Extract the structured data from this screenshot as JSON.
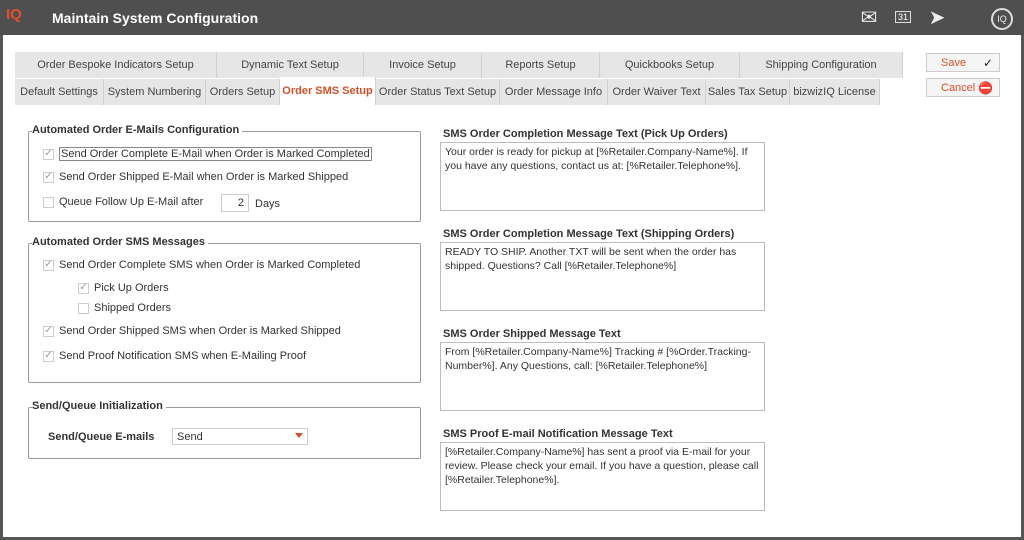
{
  "window": {
    "title": "Maintain System Configuration",
    "logo": "IQ"
  },
  "header_icons": [
    "email-icon",
    "calendar-home-icon",
    "send-icon",
    "add-iq-icon"
  ],
  "calendar_day": "31",
  "tabs_row1": [
    "Order Bespoke Indicators Setup",
    "Dynamic Text Setup",
    "Invoice Setup",
    "Reports Setup",
    "Quickbooks Setup",
    "Shipping Configuration"
  ],
  "tabs_row2": [
    "Default Settings",
    "System Numbering",
    "Orders Setup",
    "Order SMS Setup",
    "Order Status Text Setup",
    "Order Message Info",
    "Order Waiver Text",
    "Sales Tax Setup",
    "bizwizIQ License"
  ],
  "active_tab": "Order SMS Setup",
  "actions": {
    "save": "Save",
    "cancel": "Cancel"
  },
  "emails": {
    "title": "Automated Order E-Mails Configuration",
    "items": [
      {
        "label": "Send Order Complete E-Mail when Order is Marked Completed",
        "checked": true
      },
      {
        "label": "Send Order Shipped E-Mail when Order is Marked Shipped",
        "checked": true
      },
      {
        "label": "Queue Follow Up E-Mail after",
        "checked": false
      }
    ],
    "days_value": "2",
    "days_label": "Days"
  },
  "sms": {
    "title": "Automated Order SMS Messages",
    "items": [
      {
        "label": "Send Order Complete SMS when Order is Marked Completed",
        "checked": true
      },
      {
        "label": "Pick Up Orders",
        "checked": true
      },
      {
        "label": "Shipped Orders",
        "checked": false
      },
      {
        "label": "Send Order Shipped SMS when Order is Marked Shipped",
        "checked": true
      },
      {
        "label": "Send Proof Notification SMS when E-Mailing Proof",
        "checked": true
      }
    ]
  },
  "queue": {
    "title": "Send/Queue Initialization",
    "label": "Send/Queue E-mails",
    "value": "Send"
  },
  "messages": [
    {
      "label": "SMS Order Completion Message Text (Pick Up Orders)",
      "text": "Your order is ready for pickup at [%Retailer.Company-Name%]. If you have any questions, contact us at: [%Retailer.Telephone%]."
    },
    {
      "label": "SMS Order Completion Message Text (Shipping Orders)",
      "text": "READY TO SHIP. Another TXT will be sent when the order has shipped. Questions? Call [%Retailer.Telephone%]"
    },
    {
      "label": "SMS Order Shipped Message Text",
      "text": "From [%Retailer.Company-Name%] Tracking # [%Order.Tracking-Number%]. Any Questions, call: [%Retailer.Telephone%]"
    },
    {
      "label": "SMS Proof E-mail Notification Message Text",
      "text": "[%Retailer.Company-Name%] has sent a proof via E-mail for your review. Please check your email. If you have a question, please call [%Retailer.Telephone%]."
    }
  ]
}
